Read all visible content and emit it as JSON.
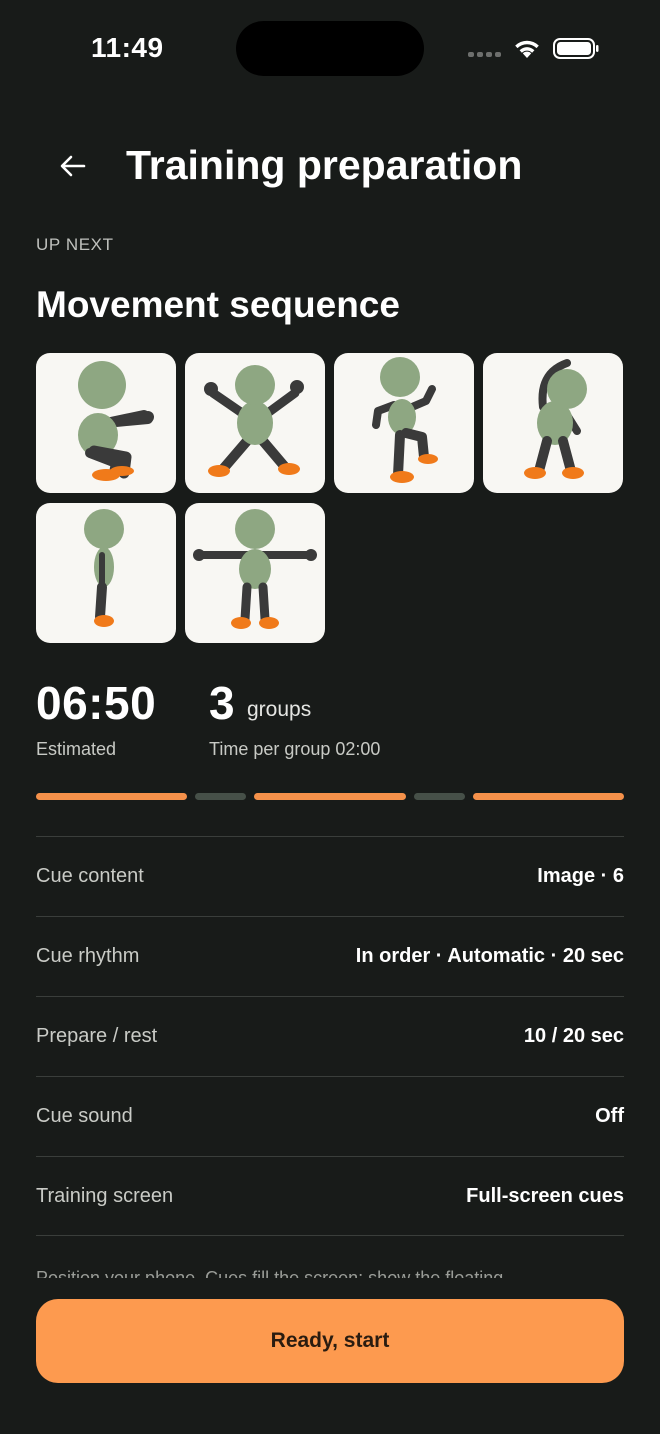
{
  "status_bar": {
    "time": "11:49"
  },
  "header": {
    "title": "Training preparation"
  },
  "section": {
    "eyebrow": "UP NEXT",
    "title": "Movement sequence"
  },
  "thumbnails": [
    {
      "icon": "squat-figure-icon"
    },
    {
      "icon": "jumping-jack-figure-icon"
    },
    {
      "icon": "high-knee-figure-icon"
    },
    {
      "icon": "side-bend-figure-icon"
    },
    {
      "icon": "standing-side-figure-icon"
    },
    {
      "icon": "t-pose-figure-icon"
    }
  ],
  "stats": {
    "estimated_time": "06:50",
    "estimated_label": "Estimated",
    "groups_count": "3",
    "groups_unit": "groups",
    "time_per_group": "Time per group 02:00"
  },
  "progress_segments": [
    "work",
    "rest",
    "work",
    "rest",
    "work"
  ],
  "settings": [
    {
      "label": "Cue content",
      "value": "Image · 6"
    },
    {
      "label": "Cue rhythm",
      "value": "In order · Automatic · 20 sec"
    },
    {
      "label": "Prepare / rest",
      "value": "10 / 20 sec"
    },
    {
      "label": "Cue sound",
      "value": "Off"
    },
    {
      "label": "Training screen",
      "value": "Full-screen cues"
    }
  ],
  "hint": "Position your phone. Cues fill the screen; show the floating",
  "start_button": "Ready, start",
  "colors": {
    "accent": "#fd9a4f",
    "background": "#181b19",
    "rest_segment": "#465048"
  }
}
